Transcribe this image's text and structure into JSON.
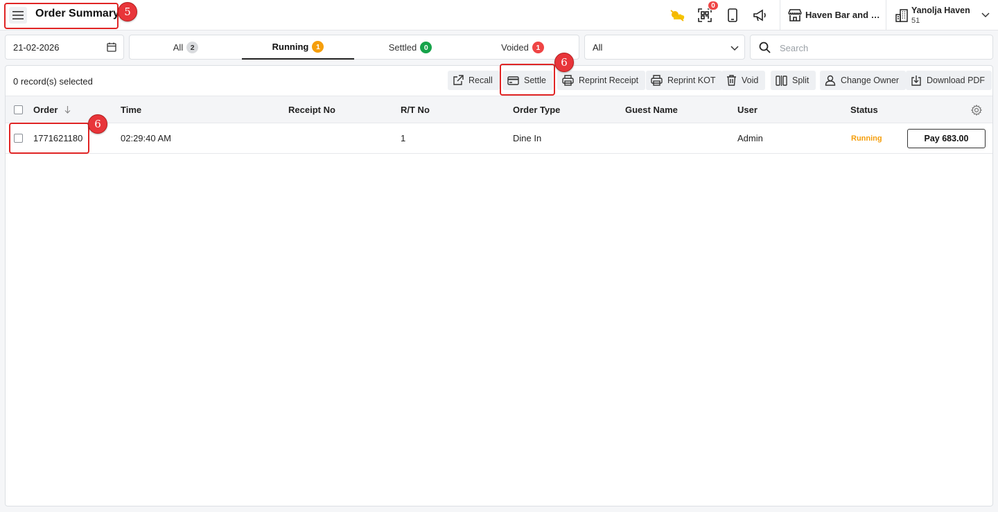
{
  "header": {
    "title": "Order Summary",
    "notification_count": "0",
    "outlet_name": "Haven Bar and Restaurant",
    "hotel_name": "Yanolja Haven",
    "hotel_code": "51",
    "icons": [
      "menu-icon",
      "weather-icon",
      "qr-scan-icon",
      "mobile-icon",
      "megaphone-icon",
      "store-icon",
      "building-icon",
      "chevron-down-icon"
    ]
  },
  "annotations": {
    "title_step": "5",
    "settle_step": "6",
    "order_step": "6",
    "color": "#e02424"
  },
  "filters": {
    "date": "21-02-2026",
    "tabs": [
      {
        "label": "All",
        "count": "2",
        "badge_color": "#d9dbde",
        "badge_text_color": "#333333"
      },
      {
        "label": "Running",
        "count": "1",
        "badge_color": "#f59e0b",
        "badge_text_color": "#ffffff"
      },
      {
        "label": "Settled",
        "count": "0",
        "badge_color": "#16a34a",
        "badge_text_color": "#ffffff"
      },
      {
        "label": "Voided",
        "count": "1",
        "badge_color": "#ef4444",
        "badge_text_color": "#ffffff"
      }
    ],
    "active_tab": "Running",
    "type_select": "All",
    "search_placeholder": "Search"
  },
  "toolbar": {
    "selected_text": "0 record(s) selected",
    "buttons": [
      {
        "label": "Recall",
        "icon": "external-link-icon"
      },
      {
        "label": "Settle",
        "icon": "card-icon"
      },
      {
        "label": "Reprint Receipt",
        "icon": "printer-icon"
      },
      {
        "label": "Reprint KOT",
        "icon": "printer-icon"
      },
      {
        "label": "Void",
        "icon": "trash-icon"
      },
      {
        "label": "Split",
        "icon": "split-icon"
      },
      {
        "label": "Change Owner",
        "icon": "user-icon"
      },
      {
        "label": "Download PDF",
        "icon": "download-icon"
      }
    ]
  },
  "table": {
    "columns": [
      "Order",
      "Time",
      "Receipt No",
      "R/T No",
      "Order Type",
      "Guest Name",
      "User",
      "Status"
    ],
    "rows": [
      {
        "order": "1771621180",
        "time": "02:29:40 AM",
        "receipt_no": "",
        "rt_no": "1",
        "order_type": "Dine In",
        "guest_name": "",
        "user": "Admin",
        "status": "Running",
        "action": "Pay 683.00"
      }
    ]
  }
}
